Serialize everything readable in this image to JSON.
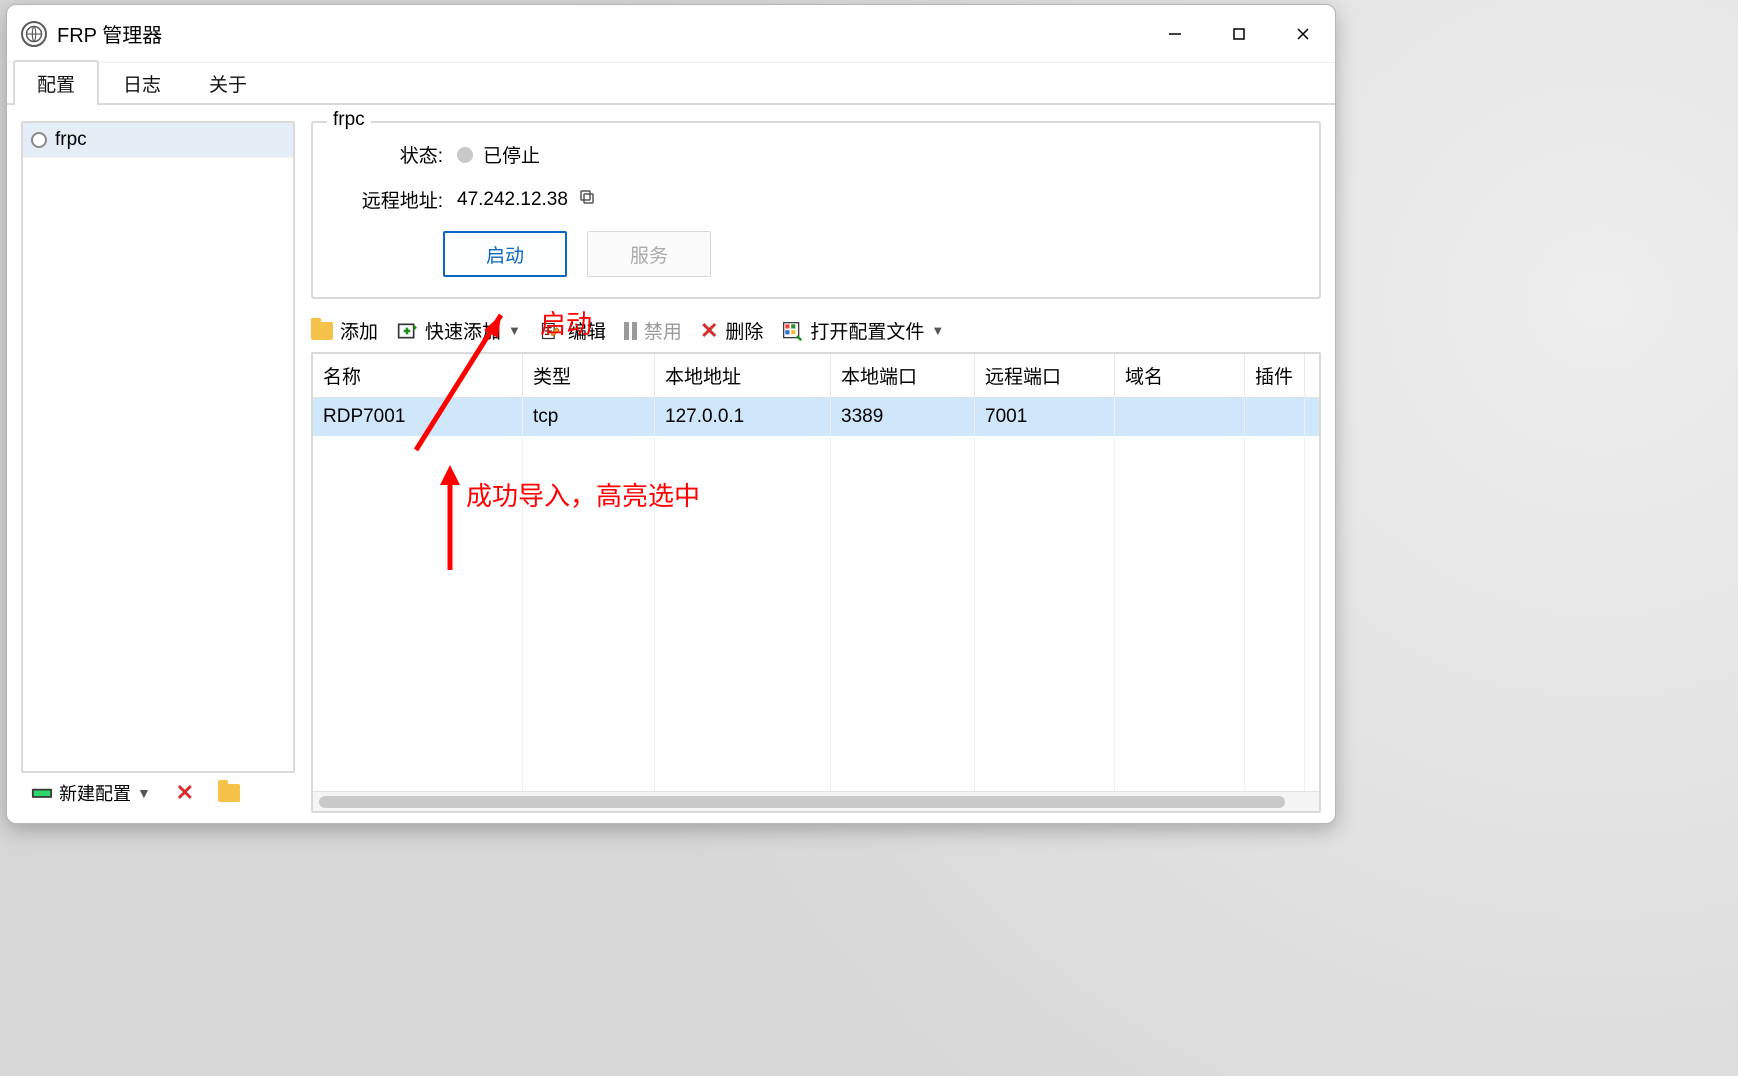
{
  "window": {
    "title": "FRP 管理器"
  },
  "tabs": {
    "items": [
      "配置",
      "日志",
      "关于"
    ],
    "active_index": 0
  },
  "sidebar": {
    "items": [
      {
        "name": "frpc"
      }
    ],
    "new_config_label": "新建配置"
  },
  "groupbox": {
    "legend": "frpc",
    "status_label": "状态:",
    "status_value": "已停止",
    "addr_label": "远程地址:",
    "addr_value": "47.242.12.38",
    "start_btn": "启动",
    "service_btn": "服务"
  },
  "toolbar": {
    "add": "添加",
    "quick_add": "快速添加",
    "edit": "编辑",
    "disable": "禁用",
    "delete": "删除",
    "open": "打开配置文件"
  },
  "table": {
    "headers": [
      "名称",
      "类型",
      "本地地址",
      "本地端口",
      "远程端口",
      "域名",
      "插件"
    ],
    "rows": [
      {
        "name": "RDP7001",
        "type": "tcp",
        "local_addr": "127.0.0.1",
        "local_port": "3389",
        "remote_port": "7001",
        "domain": "",
        "plugin": ""
      }
    ]
  },
  "annotations": {
    "start": "启动",
    "import": "成功导入，高亮选中"
  }
}
